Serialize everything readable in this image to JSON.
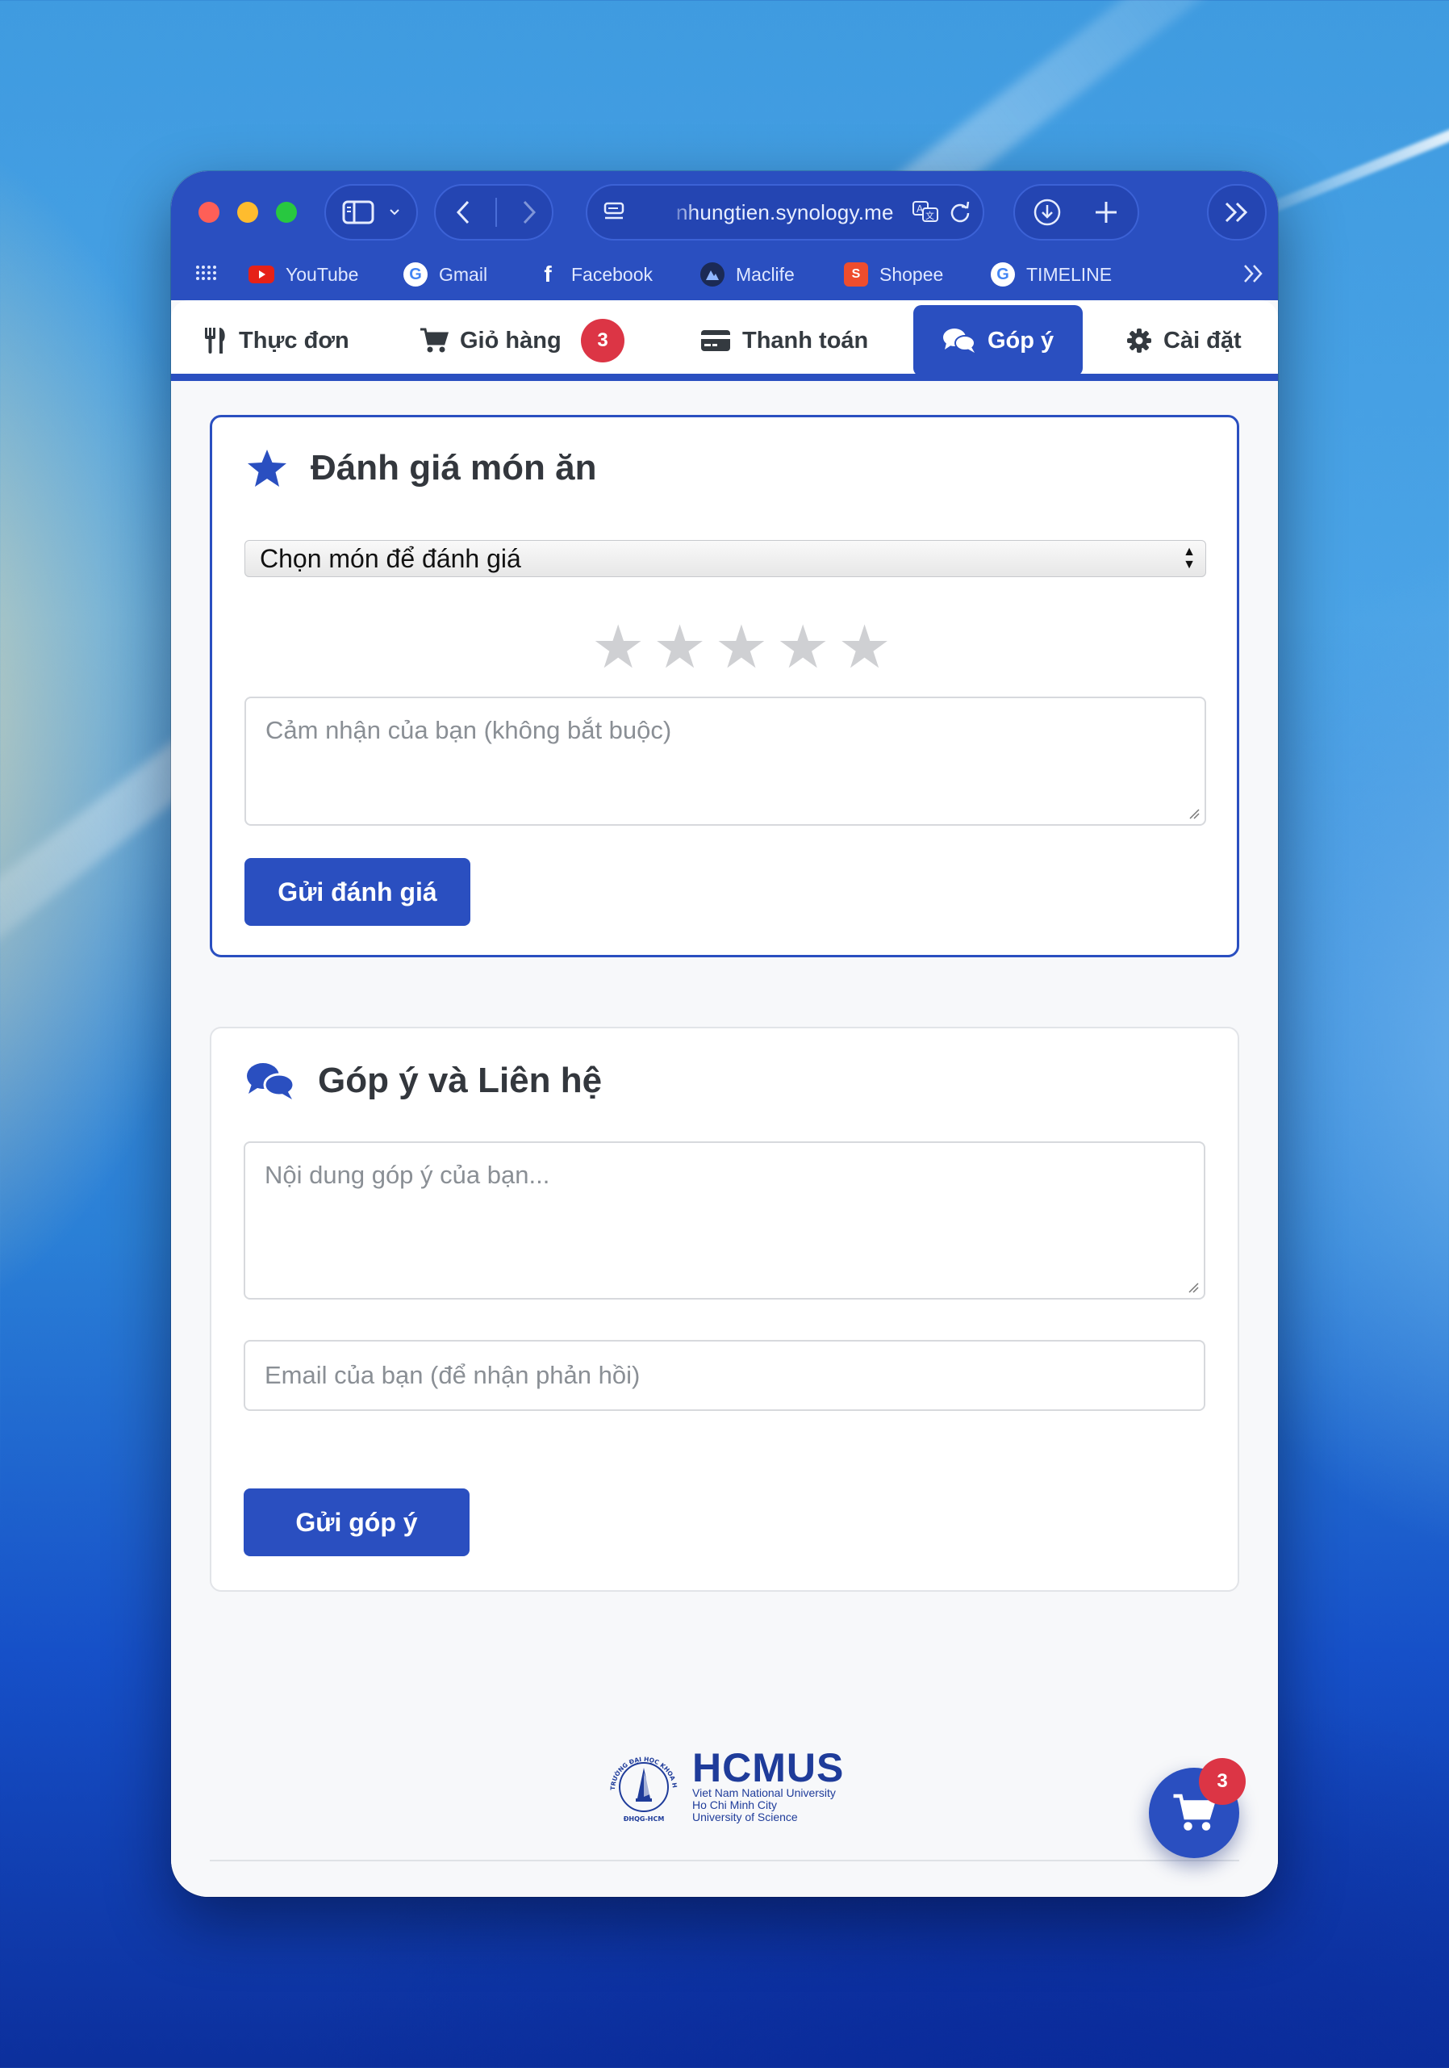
{
  "browser": {
    "url": "nhungtien.synology.me",
    "bookmarks": [
      {
        "label": "YouTube",
        "icon": "youtube-icon"
      },
      {
        "label": "Gmail",
        "icon": "google-icon"
      },
      {
        "label": "Facebook",
        "icon": "facebook-icon"
      },
      {
        "label": "Maclife",
        "icon": "maclife-icon"
      },
      {
        "label": "Shopee",
        "icon": "shopee-icon"
      },
      {
        "label": "TIMELINE",
        "icon": "google-icon"
      }
    ]
  },
  "nav": {
    "tabs": [
      {
        "label": "Thực đơn",
        "icon": "utensils-icon"
      },
      {
        "label": "Giỏ hàng",
        "icon": "cart-icon",
        "badge": "3"
      },
      {
        "label": "Thanh toán",
        "icon": "credit-card-icon"
      },
      {
        "label": "Góp ý",
        "icon": "comments-icon",
        "active": true
      },
      {
        "label": "Cài đặt",
        "icon": "gear-icon"
      }
    ]
  },
  "rating": {
    "title": "Đánh giá món ăn",
    "select_value": "Chọn món để đánh giá",
    "stars": 5,
    "stars_selected": 0,
    "comment_placeholder": "Cảm nhận của bạn (không bắt buộc)",
    "submit_label": "Gửi đánh giá"
  },
  "feedback": {
    "title": "Góp ý và Liên hệ",
    "content_placeholder": "Nội dung góp ý của bạn...",
    "email_placeholder": "Email của bạn (để nhận phản hồi)",
    "submit_label": "Gửi góp ý"
  },
  "footer": {
    "logo_name": "HCMUS",
    "logo_lines": [
      "Viet Nam National University",
      "Ho Chi Minh City",
      "University of Science"
    ],
    "logo_seal_text": "TRƯỜNG ĐẠI HỌC KHOA HỌC TỰ NHIÊN",
    "logo_seal_bottom": "ĐHQG-HCM"
  },
  "cart_fab": {
    "badge": "3"
  },
  "colors": {
    "primary": "#2a4fc0",
    "badge": "#dc3545"
  }
}
